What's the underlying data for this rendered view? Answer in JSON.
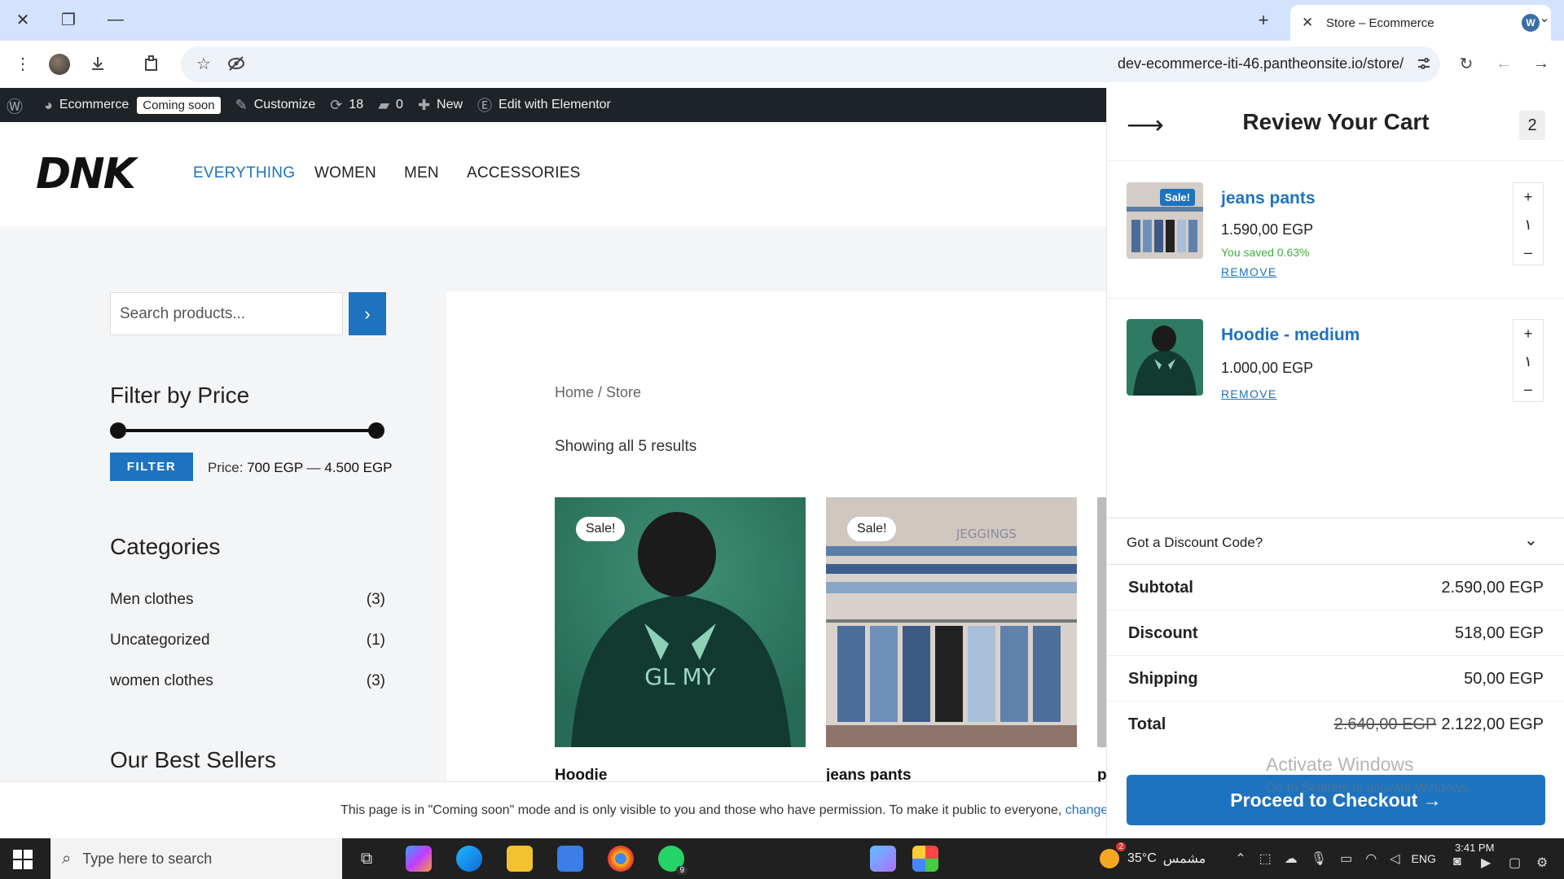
{
  "browser": {
    "tab_title": "Store – Ecommerce",
    "url": "dev-ecommerce-iti-46.pantheonsite.io/store/"
  },
  "adminbar": {
    "site_name": "Ecommerce",
    "coming_soon": "Coming soon",
    "customize": "Customize",
    "updates_count": "18",
    "comments_count": "0",
    "new": "New",
    "elementor": "Edit with Elementor"
  },
  "header": {
    "logo": "DNK",
    "nav": [
      "EVERYTHING",
      "WOMEN",
      "MEN",
      "ACCESSORIES"
    ]
  },
  "sidebar": {
    "search_placeholder": "Search products...",
    "filter_heading": "Filter by Price",
    "filter_button": "FILTER",
    "price_label": "Price:",
    "price_min": "700 EGP",
    "price_max": "4.500 EGP",
    "categories_heading": "Categories",
    "categories": [
      {
        "name": "Men clothes",
        "count": "(3)"
      },
      {
        "name": "Uncategorized",
        "count": "(1)"
      },
      {
        "name": "women clothes",
        "count": "(3)"
      }
    ],
    "best_sellers_heading": "Our Best Sellers"
  },
  "main": {
    "breadcrumb": "Home / Store",
    "results": "Showing all 5 results",
    "products": [
      {
        "name": "Hoodie",
        "badge": "Sale!",
        "art_text": "GL    MY"
      },
      {
        "name": "jeans pants",
        "badge": "Sale!",
        "art_text": "JEGGINGS"
      }
    ],
    "partial_product_initial": "p"
  },
  "cart": {
    "title": "Review Your Cart",
    "count": "2",
    "items": [
      {
        "name": "jeans pants",
        "price": "1.590,00 EGP",
        "saved": "You saved 0.63%",
        "remove": "REMOVE",
        "qty": "١",
        "badge": "Sale!"
      },
      {
        "name": "Hoodie - medium",
        "price": "1.000,00 EGP",
        "remove": "REMOVE",
        "qty": "١"
      }
    ],
    "discount_label": "Got a Discount Code?",
    "subtotal_label": "Subtotal",
    "subtotal": "2.590,00 EGP",
    "discount_row_label": "Discount",
    "discount": "518,00 EGP",
    "shipping_label": "Shipping",
    "shipping": "50,00 EGP",
    "total_label": "Total",
    "total_old": "2.640,00 EGP",
    "total": "2.122,00 EGP",
    "checkout": "Proceed to Checkout →"
  },
  "notice": {
    "text": "This page is in \"Coming soon\" mode and is only visible to you and those who have permission. To make it public to everyone, ",
    "link": "change visi"
  },
  "watermark": {
    "title": "Activate Windows",
    "sub": "Go to Settings to activate Windows."
  },
  "taskbar": {
    "search_placeholder": "Type here to search",
    "weather_temp": "35°C",
    "weather_text": "مشمس",
    "weather_badge": "2",
    "lang": "ENG",
    "time": "3:41 PM",
    "whatsapp_badge": "9"
  }
}
